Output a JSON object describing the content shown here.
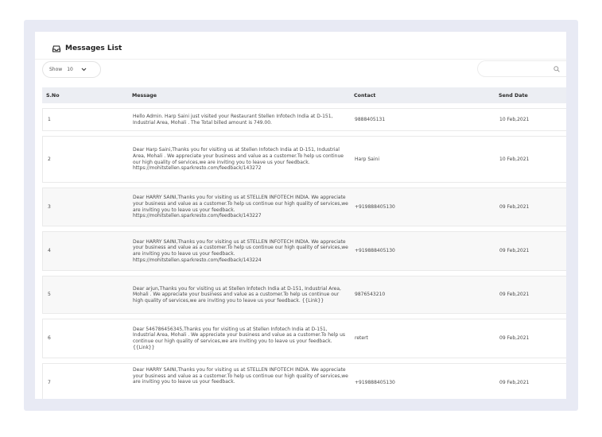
{
  "card": {
    "title": "Messages List",
    "title_icon": "inbox-icon"
  },
  "controls": {
    "show_label": "Show",
    "show_value": "10",
    "search_placeholder": "",
    "search_icon": "search-icon"
  },
  "table": {
    "headers": [
      "S.No",
      "Message",
      "Contact",
      "Send Date"
    ],
    "rows": [
      {
        "sno": "1",
        "message": "Hello Admin. Harp Saini just visited your Restaurant Stellen Infotech India at D-151, Industrial Area, Mohali . The Total billed amount is 749.00.",
        "contact": "9888405131",
        "date": "10 Feb,2021"
      },
      {
        "sno": "2",
        "message": "Dear Harp Saini,Thanks you for visiting us at Stellen Infotech India at D-151, Industrial Area, Mohali . We appreciate your business and value as a customer.To help us continue our high quality of services,we are inviting you to leave us your feedback. https://mohitstellen.sparkresto.com/feedback/143272",
        "contact": "Harp Saini",
        "date": "10 Feb,2021"
      },
      {
        "sno": "3",
        "message": "Dear HARRY SAINI,Thanks you for visiting us at STELLEN INFOTECH INDIA. We appreciate your business and value as a customer.To help us continue our high quality of services,we are inviting you to leave us your feedback. https://mohitstellen.sparkresto.com/feedback/143227",
        "contact": "+919888405130",
        "date": "09 Feb,2021"
      },
      {
        "sno": "4",
        "message": "Dear HARRY SAINI,Thanks you for visiting us at STELLEN INFOTECH INDIA. We appreciate your business and value as a customer.To help us continue our high quality of services,we are inviting you to leave us your feedback. https://mohitstellen.sparkresto.com/feedback/143224",
        "contact": "+919888405130",
        "date": "09 Feb,2021"
      },
      {
        "sno": "5",
        "message": "Dear arjun,Thanks you for visiting us at Stellen Infotech India at D-151, Industrial Area, Mohali . We appreciate your business and value as a customer.To help us continue our high quality of services,we are inviting you to leave us your feedback. {{Link}}",
        "contact": "9876543210",
        "date": "09 Feb,2021"
      },
      {
        "sno": "6",
        "message": "Dear 546786456345,Thanks you for visiting us at Stellen Infotech India at D-151, Industrial Area, Mohali . We appreciate your business and value as a customer.To help us continue our high quality of services,we are inviting you to leave us your feedback. {{Link}}",
        "contact": "retert",
        "date": "09 Feb,2021"
      },
      {
        "sno": "7",
        "message": "Dear HARRY SAINI,Thanks you for visiting us at STELLEN INFOTECH INDIA. We appreciate your business and value as a customer.To help us continue our high quality of services,we are inviting you to leave us your feedback.",
        "contact": "+919888405130",
        "date": "09 Feb,2021"
      }
    ]
  }
}
